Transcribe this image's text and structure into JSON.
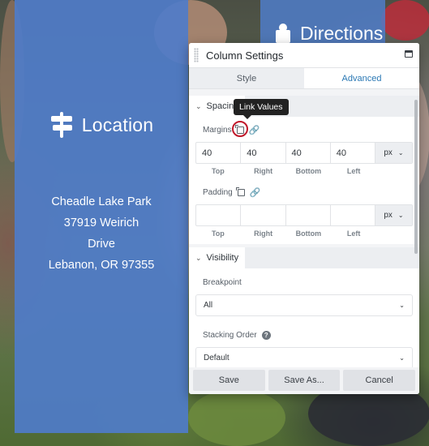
{
  "location": {
    "title": "Location",
    "address": [
      "Cheadle Lake Park",
      "37919 Weirich",
      "Drive",
      "Lebanon, OR 97355"
    ]
  },
  "directions": {
    "title": "Directions"
  },
  "dialog": {
    "title": "Column Settings",
    "tabs": [
      {
        "label": "Style"
      },
      {
        "label": "Advanced"
      }
    ],
    "spacing_section": "Spacing",
    "tooltip": "Link Values",
    "margins": {
      "label": "Margins",
      "values": [
        "40",
        "40",
        "40",
        "40"
      ],
      "unit": "px"
    },
    "padding": {
      "label": "Padding",
      "values": [
        "",
        "",
        "",
        ""
      ],
      "unit": "px"
    },
    "sides": [
      "Top",
      "Right",
      "Bottom",
      "Left"
    ],
    "visibility_section": "Visibility",
    "breakpoint": {
      "label": "Breakpoint",
      "value": "All"
    },
    "stacking": {
      "label": "Stacking Order",
      "value": "Default"
    },
    "buttons": {
      "save": "Save",
      "save_as": "Save As...",
      "cancel": "Cancel"
    }
  },
  "colors": {
    "panel_blue": "#4f7cc9",
    "accent": "#2a78b4",
    "highlight_circle": "#c0182a"
  }
}
